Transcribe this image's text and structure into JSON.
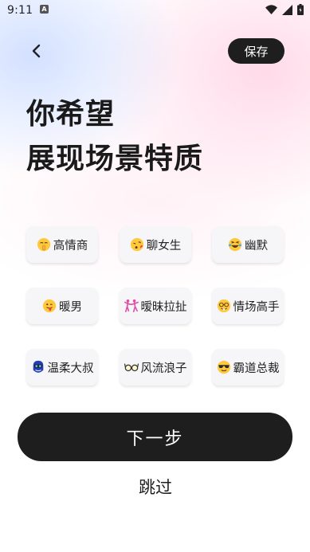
{
  "status_bar": {
    "time": "9:11",
    "icons": [
      "notification-a-icon",
      "wifi-icon",
      "signal-icon",
      "battery-icon"
    ]
  },
  "header": {
    "back_icon": "chevron-left-icon",
    "save_label": "保存"
  },
  "title": {
    "line1": "你希望",
    "line2": "展现场景特质"
  },
  "tags": [
    {
      "label": "高情商",
      "icon": "shush-face-icon"
    },
    {
      "label": "聊女生",
      "icon": "kissing-face-icon"
    },
    {
      "label": "幽默",
      "icon": "laughing-tears-face-icon"
    },
    {
      "label": "暖男",
      "icon": "tongue-face-icon"
    },
    {
      "label": "暧昧拉扯",
      "icon": "dancing-people-icon"
    },
    {
      "label": "情场高手",
      "icon": "nerd-face-icon"
    },
    {
      "label": "温柔大叔",
      "icon": "bearded-man-icon"
    },
    {
      "label": "风流浪子",
      "icon": "glasses-icon"
    },
    {
      "label": "霸道总裁",
      "icon": "sunglasses-face-icon"
    }
  ],
  "actions": {
    "next_label": "下一步",
    "skip_label": "跳过"
  },
  "colors": {
    "button_dark": "#1e1e1e",
    "tag_background": "#f6f6f8"
  }
}
